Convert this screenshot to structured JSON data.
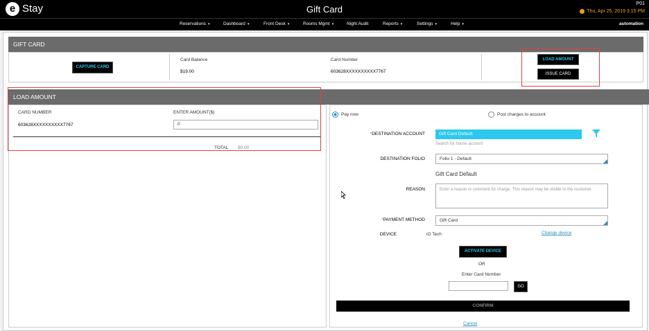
{
  "app": {
    "logo_letter": "e",
    "logo_text": "Stay",
    "window_title": "Gift Card",
    "property_code": "P01",
    "datetime": "Thu, Apr 25, 2019 3:15 PM",
    "user": "automation"
  },
  "nav": {
    "items": [
      "Reservations",
      "Dashboard",
      "Front Desk",
      "Rooms Mgmt",
      "Night Audit",
      "Reports",
      "Settings",
      "Help"
    ],
    "carets": [
      "▾",
      "▾",
      "▾",
      "▾",
      "",
      "▾",
      "▾",
      "▾"
    ]
  },
  "gift_card": {
    "header": "GIFT CARD",
    "capture_button": "CAPTURE CARD",
    "balance_label": "Card Balance",
    "balance_value": "$19.00",
    "number_label": "Card Number",
    "number_value": "603628XXXXXXXXXX7767",
    "load_amount_button": "LOAD AMOUNT",
    "issue_card_button": "ISSUE CARD"
  },
  "load_amount": {
    "header": "LOAD AMOUNT",
    "card_number_label": "CARD NUMBER",
    "card_number_value": "603628XXXXXXXXXX7767",
    "enter_amount_label": "ENTER AMOUNT($)",
    "amount_value": "0",
    "total_label": "TOTAL",
    "total_value": "$0.00"
  },
  "payment": {
    "pay_now_label": "Pay now",
    "post_charges_label": "Post charges to account",
    "destination_account_label": "DESTINATION ACCOUNT",
    "destination_account_value": "Gift Card Default",
    "destination_account_hint": "Search for house account",
    "destination_folio_label": "DESTINATION FOLIO",
    "destination_folio_value": "Folio 1 - Default",
    "folio_account_name": "Gift Card Default",
    "reason_label": "REASON",
    "reason_placeholder": "Enter a reason or comment for charge. This reason may be visible to the customer.",
    "payment_method_label": "PAYMENT METHOD",
    "payment_method_value": "Gift Card",
    "device_label": "DEVICE",
    "device_value": "iO Tech",
    "change_device_link": "Change device",
    "activate_device_button": "ACTIVATE DEVICE",
    "or_text": "OR",
    "enter_card_label": "Enter Card Number",
    "go_button": "GO",
    "confirm_button": "CONFIRM",
    "cancel_link": "Cancel",
    "required_mark": "*"
  },
  "colors": {
    "accent": "#2cc8f0",
    "highlight_box": "#e04040",
    "section_header": "#6b6b6b"
  }
}
